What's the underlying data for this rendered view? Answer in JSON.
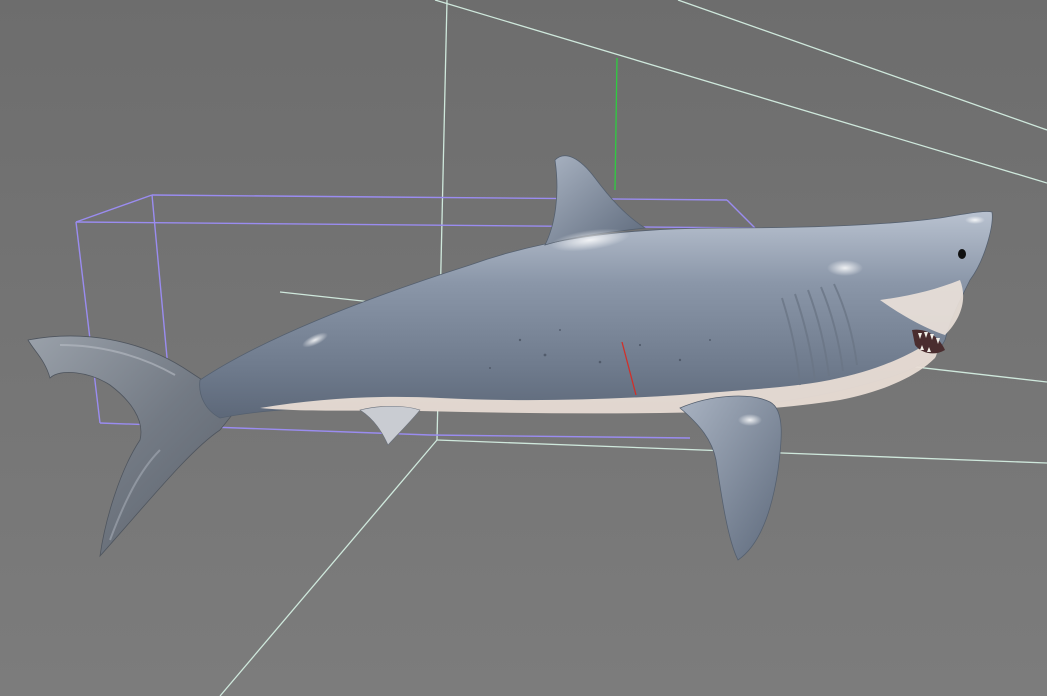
{
  "viewport": {
    "background_color": "#747474",
    "guide_line_color": "#cfe8dc",
    "bounding_box_color": "#9a8cf0",
    "y_axis_color": "#2ecc40",
    "x_axis_color": "#d0302a"
  },
  "model": {
    "icon": "shark-model",
    "body_color": "#7f8c9f",
    "belly_color": "#e8dcd4"
  }
}
